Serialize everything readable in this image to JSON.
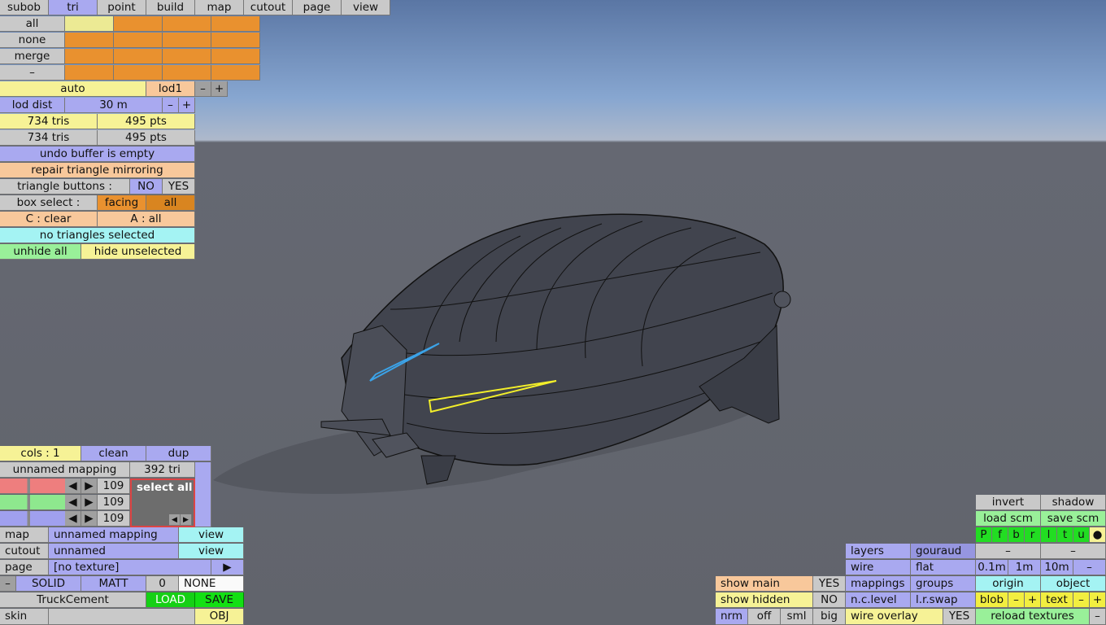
{
  "tabs": [
    "subob",
    "tri",
    "point",
    "build",
    "map",
    "cutout",
    "page",
    "view"
  ],
  "selection": {
    "all": "all",
    "none": "none",
    "merge": "merge",
    "dash": "–"
  },
  "lod": {
    "auto": "auto",
    "lod1": "lod1",
    "minus": "–",
    "plus": "+",
    "dist_label": "lod dist",
    "dist_value": "30 m"
  },
  "stats": {
    "tris1": "734 tris",
    "pts1": "495 pts",
    "tris2": "734 tris",
    "pts2": "495 pts"
  },
  "undo": "undo buffer is empty",
  "repair": "repair triangle mirroring",
  "triangle_buttons": {
    "label": "triangle buttons :",
    "no": "NO",
    "yes": "YES"
  },
  "box_select": {
    "label": "box select :",
    "facing": "facing",
    "all": "all"
  },
  "keys": {
    "clear": "C : clear",
    "all": "A : all"
  },
  "selected_status": "no triangles selected",
  "hide": {
    "unhide": "unhide all",
    "hide_unselected": "hide unselected"
  },
  "mapping": {
    "cols": "cols : 1",
    "clean": "clean",
    "dup": "dup",
    "name": "unnamed mapping",
    "tri": "392 tri",
    "r": "109",
    "g": "109",
    "b": "109",
    "select_all": "select all"
  },
  "bottom_left": {
    "map": "map",
    "map_val": "unnamed mapping",
    "view1": "view",
    "cutout": "cutout",
    "cutout_val": "unnamed",
    "view2": "view",
    "page": "page",
    "page_val": "[no texture]",
    "play": "▶",
    "minus": "–",
    "solid": "SOLID",
    "matt": "MATT",
    "zero": "0",
    "none": "NONE",
    "name": "TruckCement",
    "load": "LOAD",
    "save": "SAVE",
    "skin": "skin",
    "obj": "OBJ"
  },
  "bottom_mid": {
    "show_main": "show main",
    "show_main_val": "YES",
    "show_hidden": "show hidden",
    "show_hidden_val": "NO",
    "nrm": "nrm",
    "off": "off",
    "sml": "sml",
    "big": "big"
  },
  "bottom_right": {
    "layers": "layers",
    "gouraud": "gouraud",
    "wire": "wire",
    "flat": "flat",
    "mappings": "mappings",
    "groups": "groups",
    "nclevel": "n.c.level",
    "lrswap": "l.r.swap",
    "wire_overlay": "wire overlay",
    "wire_overlay_val": "YES"
  },
  "far_right": {
    "invert": "invert",
    "shadow": "shadow",
    "load_scm": "load scm",
    "save_scm": "save scm",
    "flags": [
      "P",
      "f",
      "b",
      "r",
      "l",
      "t",
      "u",
      "●"
    ],
    "dash1": "–",
    "dash2": "–",
    "s01": "0.1m",
    "s1": "1m",
    "s10": "10m",
    "sminus": "–",
    "origin": "origin",
    "object": "object",
    "blob": "blob",
    "blob_minus": "–",
    "blob_plus": "+",
    "text": "text",
    "text_minus": "–",
    "text_plus": "+",
    "reload": "reload textures",
    "reload_minus": "–"
  }
}
